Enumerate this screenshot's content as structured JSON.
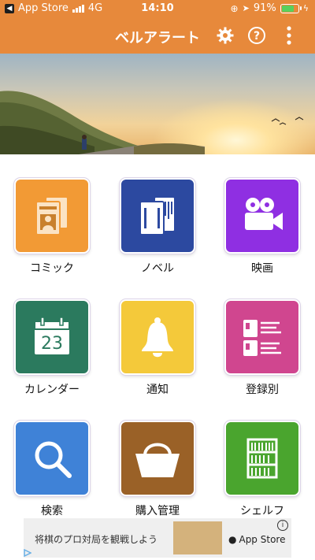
{
  "status_bar": {
    "back_app": "App Store",
    "network": "4G",
    "time": "14:10",
    "battery": "91%",
    "battery_level": 0.91
  },
  "header": {
    "title": "ベルアラート",
    "icons": [
      "gear-icon",
      "help-icon",
      "more-icon"
    ]
  },
  "menu": [
    {
      "label": "コミック",
      "icon": "comic-icon",
      "color": "#f29a35"
    },
    {
      "label": "ノベル",
      "icon": "novel-icon",
      "color": "#2c49a0"
    },
    {
      "label": "映画",
      "icon": "movie-camera-icon",
      "color": "#8f2fe2"
    },
    {
      "label": "カレンダー",
      "icon": "calendar-icon",
      "color": "#2b7a5e"
    },
    {
      "label": "通知",
      "icon": "bell-icon",
      "color": "#f4c93a"
    },
    {
      "label": "登録別",
      "icon": "list-icon",
      "color": "#d0468f"
    },
    {
      "label": "検索",
      "icon": "search-icon",
      "color": "#3f82d7"
    },
    {
      "label": "購入管理",
      "icon": "basket-icon",
      "color": "#9a6127"
    },
    {
      "label": "シェルフ",
      "icon": "bookshelf-icon",
      "color": "#4aa52e"
    }
  ],
  "calendar_day": "23",
  "ad": {
    "text": "将棋のプロ対局を観戦しよう",
    "store": "App Store"
  }
}
